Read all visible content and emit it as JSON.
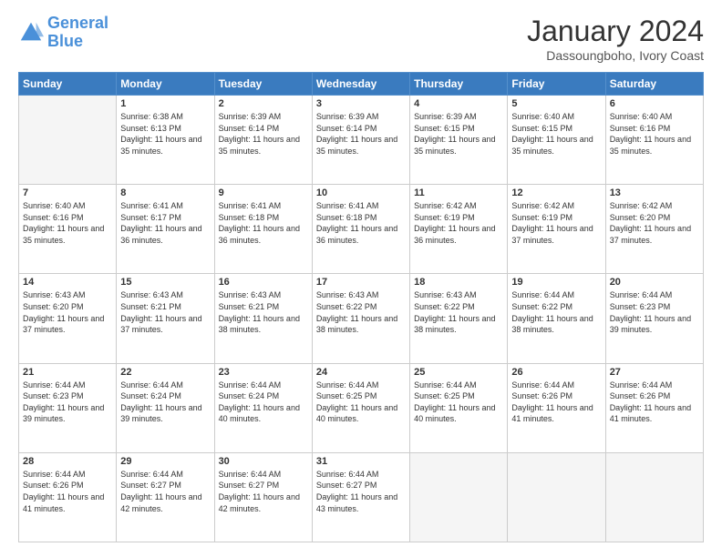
{
  "logo": {
    "line1": "General",
    "line2": "Blue"
  },
  "header": {
    "month": "January 2024",
    "location": "Dassoungboho, Ivory Coast"
  },
  "weekdays": [
    "Sunday",
    "Monday",
    "Tuesday",
    "Wednesday",
    "Thursday",
    "Friday",
    "Saturday"
  ],
  "weeks": [
    [
      {
        "day": "",
        "empty": true
      },
      {
        "day": "1",
        "sunrise": "6:38 AM",
        "sunset": "6:13 PM",
        "daylight": "11 hours and 35 minutes."
      },
      {
        "day": "2",
        "sunrise": "6:39 AM",
        "sunset": "6:14 PM",
        "daylight": "11 hours and 35 minutes."
      },
      {
        "day": "3",
        "sunrise": "6:39 AM",
        "sunset": "6:14 PM",
        "daylight": "11 hours and 35 minutes."
      },
      {
        "day": "4",
        "sunrise": "6:39 AM",
        "sunset": "6:15 PM",
        "daylight": "11 hours and 35 minutes."
      },
      {
        "day": "5",
        "sunrise": "6:40 AM",
        "sunset": "6:15 PM",
        "daylight": "11 hours and 35 minutes."
      },
      {
        "day": "6",
        "sunrise": "6:40 AM",
        "sunset": "6:16 PM",
        "daylight": "11 hours and 35 minutes."
      }
    ],
    [
      {
        "day": "7",
        "sunrise": "6:40 AM",
        "sunset": "6:16 PM",
        "daylight": "11 hours and 35 minutes."
      },
      {
        "day": "8",
        "sunrise": "6:41 AM",
        "sunset": "6:17 PM",
        "daylight": "11 hours and 36 minutes."
      },
      {
        "day": "9",
        "sunrise": "6:41 AM",
        "sunset": "6:18 PM",
        "daylight": "11 hours and 36 minutes."
      },
      {
        "day": "10",
        "sunrise": "6:41 AM",
        "sunset": "6:18 PM",
        "daylight": "11 hours and 36 minutes."
      },
      {
        "day": "11",
        "sunrise": "6:42 AM",
        "sunset": "6:19 PM",
        "daylight": "11 hours and 36 minutes."
      },
      {
        "day": "12",
        "sunrise": "6:42 AM",
        "sunset": "6:19 PM",
        "daylight": "11 hours and 37 minutes."
      },
      {
        "day": "13",
        "sunrise": "6:42 AM",
        "sunset": "6:20 PM",
        "daylight": "11 hours and 37 minutes."
      }
    ],
    [
      {
        "day": "14",
        "sunrise": "6:43 AM",
        "sunset": "6:20 PM",
        "daylight": "11 hours and 37 minutes."
      },
      {
        "day": "15",
        "sunrise": "6:43 AM",
        "sunset": "6:21 PM",
        "daylight": "11 hours and 37 minutes."
      },
      {
        "day": "16",
        "sunrise": "6:43 AM",
        "sunset": "6:21 PM",
        "daylight": "11 hours and 38 minutes."
      },
      {
        "day": "17",
        "sunrise": "6:43 AM",
        "sunset": "6:22 PM",
        "daylight": "11 hours and 38 minutes."
      },
      {
        "day": "18",
        "sunrise": "6:43 AM",
        "sunset": "6:22 PM",
        "daylight": "11 hours and 38 minutes."
      },
      {
        "day": "19",
        "sunrise": "6:44 AM",
        "sunset": "6:22 PM",
        "daylight": "11 hours and 38 minutes."
      },
      {
        "day": "20",
        "sunrise": "6:44 AM",
        "sunset": "6:23 PM",
        "daylight": "11 hours and 39 minutes."
      }
    ],
    [
      {
        "day": "21",
        "sunrise": "6:44 AM",
        "sunset": "6:23 PM",
        "daylight": "11 hours and 39 minutes."
      },
      {
        "day": "22",
        "sunrise": "6:44 AM",
        "sunset": "6:24 PM",
        "daylight": "11 hours and 39 minutes."
      },
      {
        "day": "23",
        "sunrise": "6:44 AM",
        "sunset": "6:24 PM",
        "daylight": "11 hours and 40 minutes."
      },
      {
        "day": "24",
        "sunrise": "6:44 AM",
        "sunset": "6:25 PM",
        "daylight": "11 hours and 40 minutes."
      },
      {
        "day": "25",
        "sunrise": "6:44 AM",
        "sunset": "6:25 PM",
        "daylight": "11 hours and 40 minutes."
      },
      {
        "day": "26",
        "sunrise": "6:44 AM",
        "sunset": "6:26 PM",
        "daylight": "11 hours and 41 minutes."
      },
      {
        "day": "27",
        "sunrise": "6:44 AM",
        "sunset": "6:26 PM",
        "daylight": "11 hours and 41 minutes."
      }
    ],
    [
      {
        "day": "28",
        "sunrise": "6:44 AM",
        "sunset": "6:26 PM",
        "daylight": "11 hours and 41 minutes."
      },
      {
        "day": "29",
        "sunrise": "6:44 AM",
        "sunset": "6:27 PM",
        "daylight": "11 hours and 42 minutes."
      },
      {
        "day": "30",
        "sunrise": "6:44 AM",
        "sunset": "6:27 PM",
        "daylight": "11 hours and 42 minutes."
      },
      {
        "day": "31",
        "sunrise": "6:44 AM",
        "sunset": "6:27 PM",
        "daylight": "11 hours and 43 minutes."
      },
      {
        "day": "",
        "empty": true
      },
      {
        "day": "",
        "empty": true
      },
      {
        "day": "",
        "empty": true
      }
    ]
  ]
}
